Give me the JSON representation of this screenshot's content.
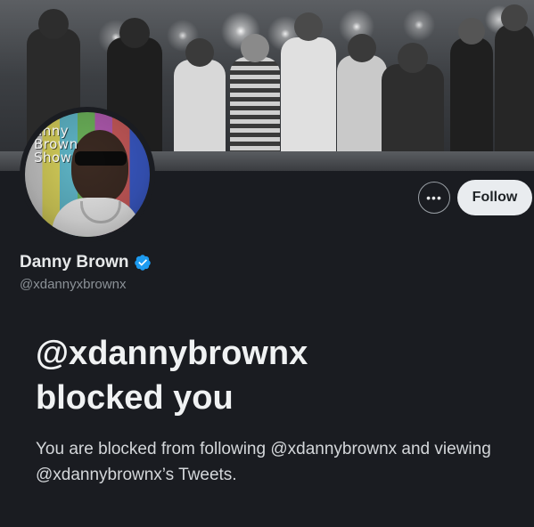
{
  "banner": {
    "description_icon": "concert-photo"
  },
  "avatar": {
    "show_text": "anny Brown Show"
  },
  "header_actions": {
    "more_label": "•••",
    "follow_label": "Follow"
  },
  "profile": {
    "display_name": "Danny Brown",
    "handle": "@xdannyxbrownx",
    "verified_color": "#1d9bf0"
  },
  "blocked": {
    "title_line1": "@xdannybrownx",
    "title_line2": "blocked you",
    "description": "You are blocked from following @xdannybrownx and viewing @xdannybrownx’s Tweets."
  },
  "colors": {
    "background": "#1a1c21",
    "follow_bg": "#e9ecef",
    "text_primary": "#e7e9ea",
    "text_secondary": "#8b9197"
  }
}
